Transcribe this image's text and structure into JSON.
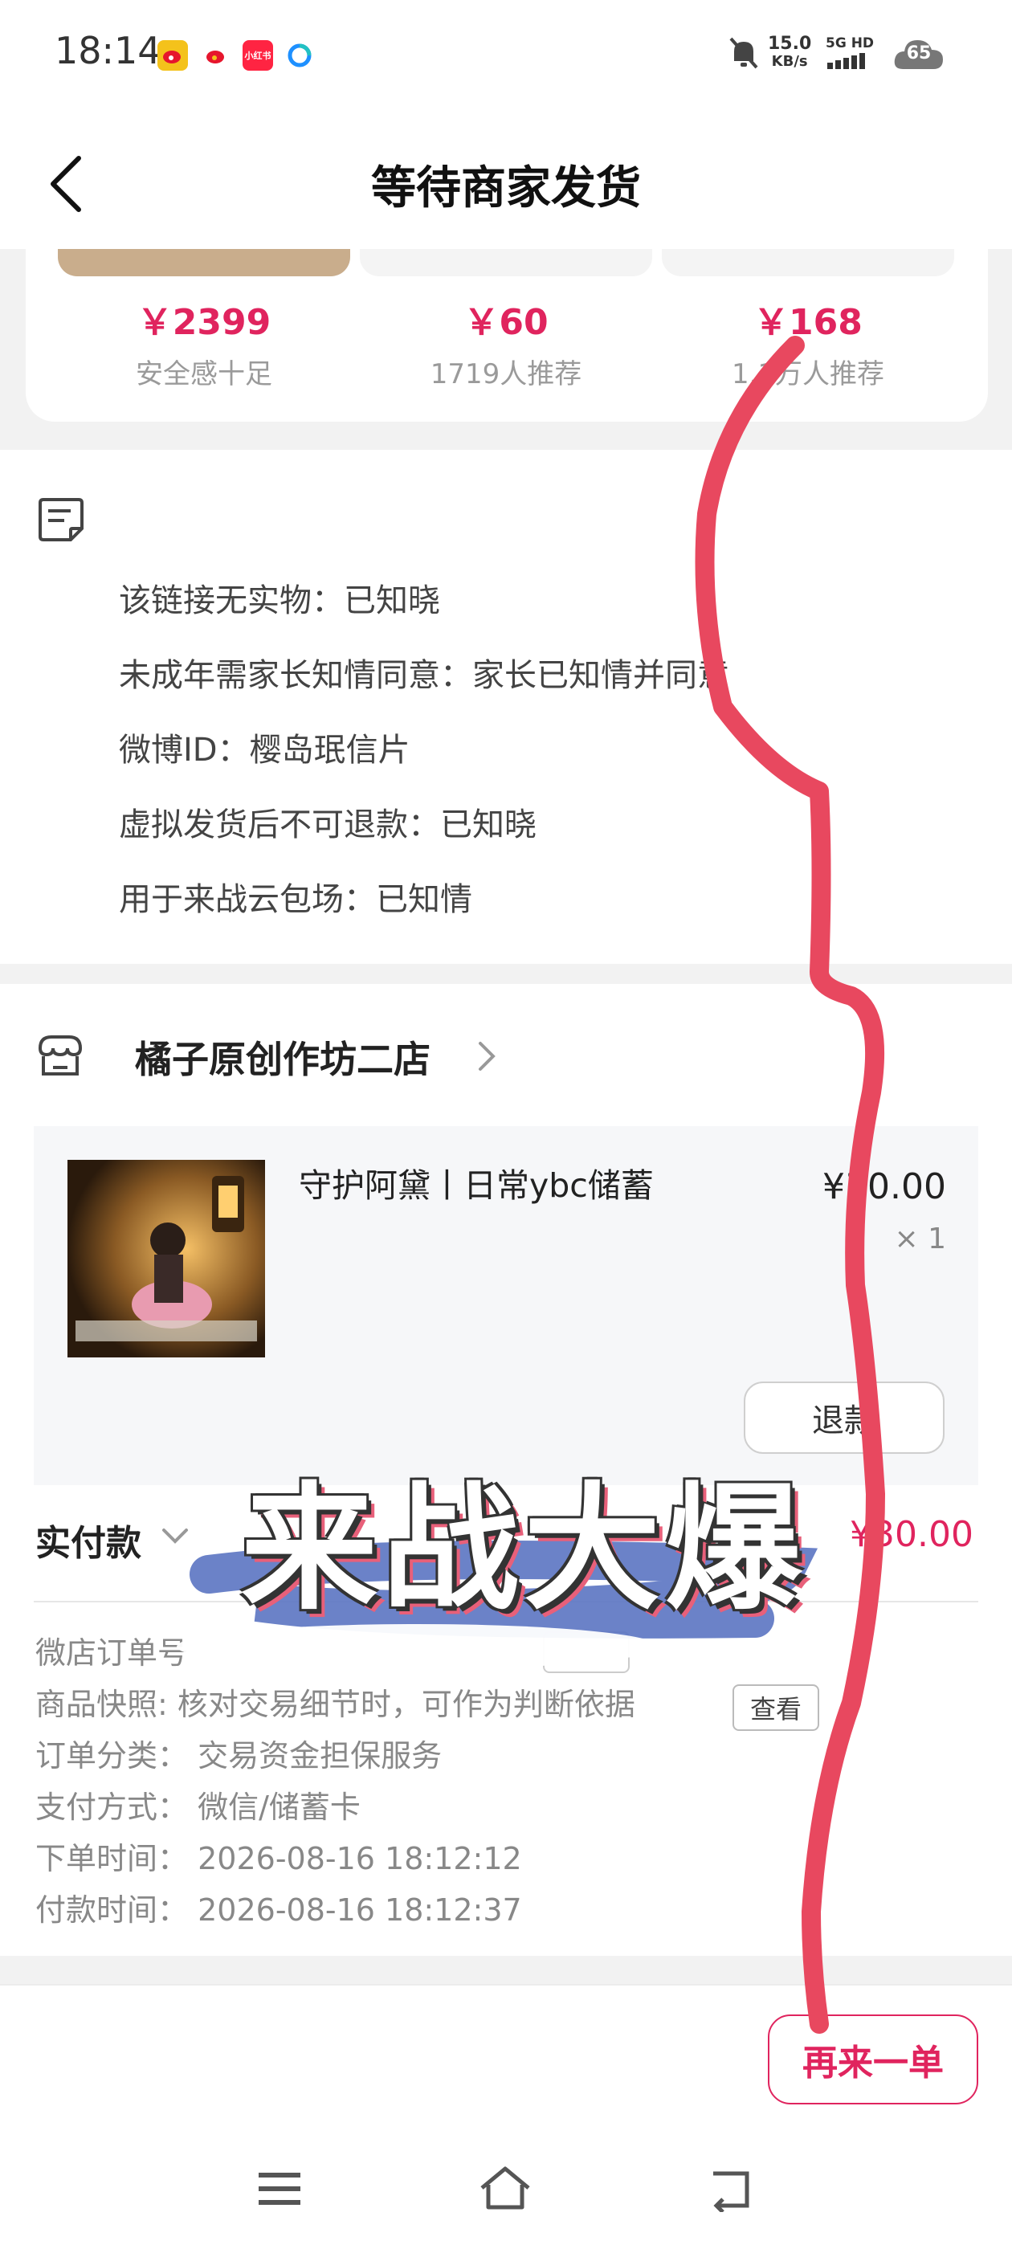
{
  "status_bar": {
    "time": "18:14",
    "app_icons": [
      "weibo-icon",
      "weibo-icon",
      "xiaohongshu-icon",
      "browser-icon"
    ],
    "app_icon_labels": [
      "",
      "",
      "小红书",
      ""
    ],
    "net_speed_value": "15.0",
    "net_speed_unit": "KB/s",
    "signal_label": "5G HD",
    "battery": "65"
  },
  "nav": {
    "title": "等待商家发货"
  },
  "recommend": [
    {
      "price": "￥2399",
      "sub": "安全感十足"
    },
    {
      "price": "￥60",
      "sub": "1719人推荐"
    },
    {
      "price": "￥168",
      "sub": "1.1万人推荐"
    }
  ],
  "notes": [
    "该链接无实物：已知晓",
    "未成年需家长知情同意：家长已知情并同意",
    "微博ID：樱岛珉信片",
    "虚拟发货后不可退款：已知晓",
    "用于来战云包场：已知情"
  ],
  "store": {
    "name": "橘子原创作坊二店"
  },
  "item": {
    "title": "守护阿黛丨日常ybc储蓄",
    "price": "¥30.00",
    "qty": "× 1",
    "refund_label": "退款"
  },
  "payment": {
    "label": "实付款",
    "amount": "¥30.00"
  },
  "order_info": [
    {
      "label": "微店订单号",
      "value": ""
    },
    {
      "label": "商品快照:",
      "value": "核对交易细节时，可作为判断依据"
    },
    {
      "label": "订单分类：",
      "value": "交易资金担保服务"
    },
    {
      "label": "支付方式：",
      "value": "微信/储蓄卡"
    },
    {
      "label": "下单时间：",
      "value": "2026-08-16 18:12:12"
    },
    {
      "label": "付款时间：",
      "value": "2026-08-16 18:12:37"
    }
  ],
  "view_label": "查看",
  "reorder_label": "再来一单",
  "overlay_text": "来战大爆",
  "colors": {
    "accent": "#e0245e",
    "scribble": "#e8485f",
    "scribble_blue": "#5b74c2"
  }
}
